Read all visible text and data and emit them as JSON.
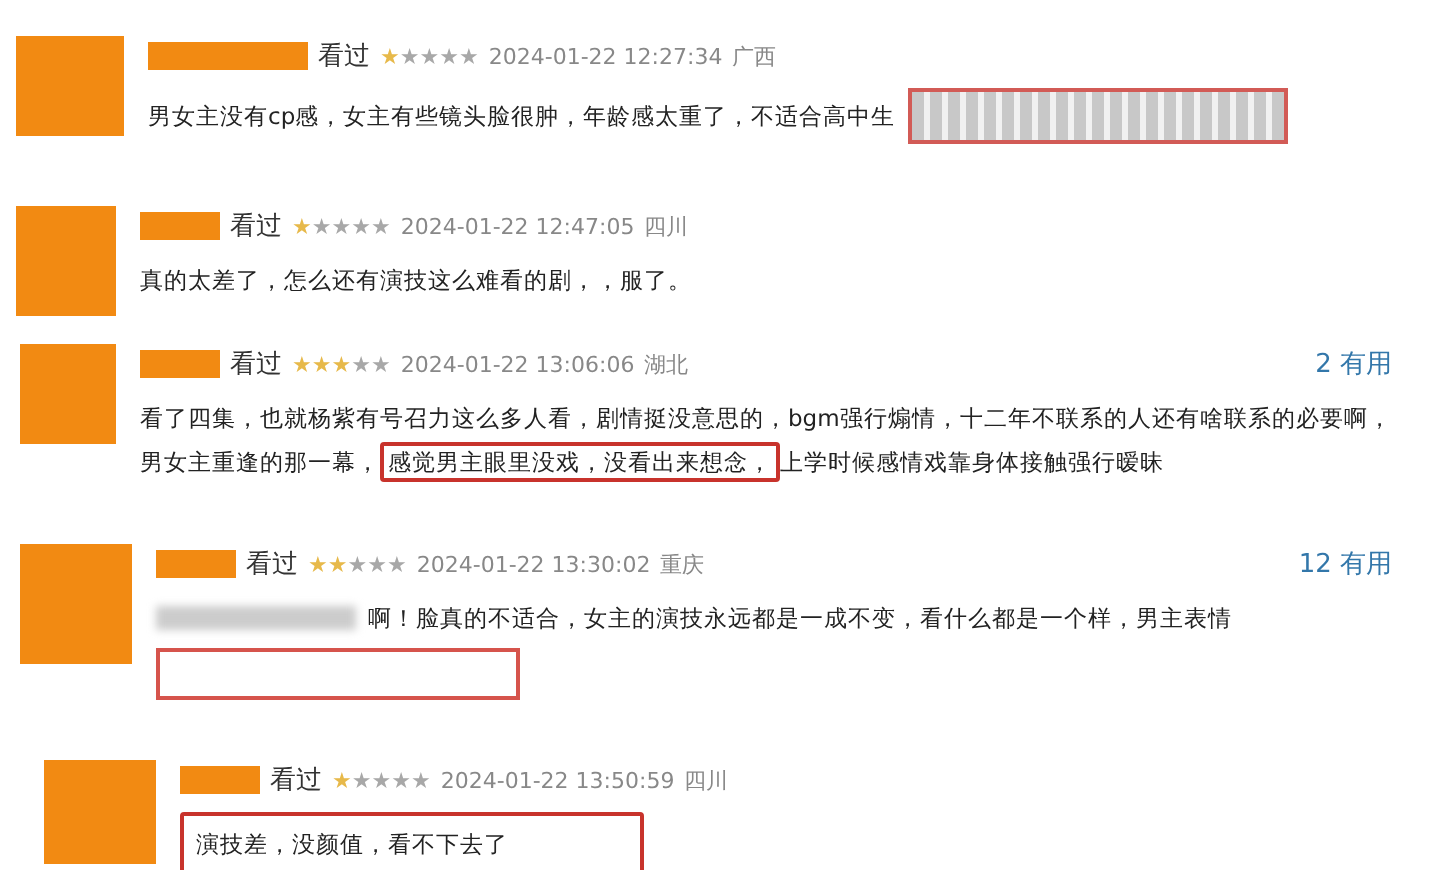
{
  "reviews": [
    {
      "status": "看过",
      "stars": 1,
      "time": "2024-01-22 12:27:34",
      "location": "广西",
      "clipping": true,
      "parts": [
        {
          "text": "男女主没有cp感，女主有些镜头脸很肿，年龄感太重了，不适合高中生",
          "highlight": false
        }
      ]
    },
    {
      "status": "看过",
      "stars": 1,
      "time": "2024-01-22 12:47:05",
      "location": "四川",
      "parts": [
        {
          "text": "真的太差了，怎么还有演技这么难看的剧，，服了。",
          "highlight": false
        }
      ]
    },
    {
      "status": "看过",
      "stars": 3,
      "time": "2024-01-22 13:06:06",
      "location": "湖北",
      "useful": "2",
      "useful_label": "有用",
      "parts": [
        {
          "text": "看了四集，也就杨紫有号召力这么多人看，剧情挺没意思的，bgm强行煽情，十二年不联系的人还有啥联系的必要啊，男女主重逢的那一幕，",
          "highlight": false
        },
        {
          "text": "感觉男主眼里没戏，没看出来想念，",
          "highlight": true
        },
        {
          "text": "上学时候感情戏靠身体接触强行暧昧",
          "highlight": false
        }
      ]
    },
    {
      "status": "看过",
      "stars": 2,
      "time": "2024-01-22 13:30:02",
      "location": "重庆",
      "useful": "12",
      "useful_label": "有用",
      "blurred_prefix": true,
      "empty_box": true,
      "parts": [
        {
          "text": "啊！脸真的不适合，女主的演技永远都是一成不变，看什么都是一个样，男主表情",
          "highlight": false
        }
      ]
    },
    {
      "status": "看过",
      "stars": 1,
      "time": "2024-01-22 13:50:59",
      "location": "四川",
      "parts": [
        {
          "text": "演技差，没颜值，看不下去了",
          "highlight": true
        }
      ]
    }
  ]
}
